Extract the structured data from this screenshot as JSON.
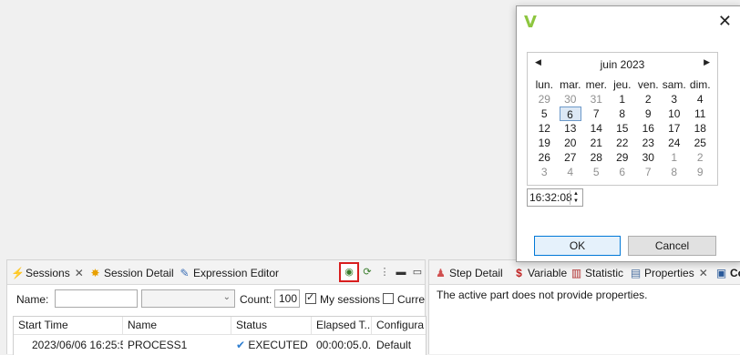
{
  "sessions_panel": {
    "tabs": [
      {
        "label": "Sessions",
        "icon": "lightning-icon"
      },
      {
        "label": "Session Detail",
        "icon": "session-detail-icon"
      },
      {
        "label": "Expression Editor",
        "icon": "pencil-icon"
      }
    ],
    "filter": {
      "name_label": "Name:",
      "name_value": "",
      "count_label": "Count:",
      "count_value": "100",
      "my_sessions_label": "My sessions",
      "my_sessions_checked": true,
      "current_label": "Curre",
      "current_checked": false
    },
    "table": {
      "columns": [
        "Start Time",
        "Name",
        "Status",
        "Elapsed T...",
        "Configura"
      ],
      "rows": [
        [
          "2023/06/06 16:25:5",
          "PROCESS1",
          "EXECUTED",
          "00:00:05.0...",
          "Default"
        ]
      ]
    }
  },
  "props_panel": {
    "tabs": [
      {
        "label": "Step Detail",
        "icon": "step-detail-icon"
      },
      {
        "label": "Variable",
        "icon": "variable-icon"
      },
      {
        "label": "Statistic",
        "icon": "statistic-icon"
      },
      {
        "label": "Properties",
        "icon": "properties-icon"
      },
      {
        "label": "Co",
        "icon": "console-icon"
      }
    ],
    "message": "The active part does not provide properties."
  },
  "dialog": {
    "month_label": "juin 2023",
    "weekdays": [
      "lun.",
      "mar.",
      "mer.",
      "jeu.",
      "ven.",
      "sam.",
      "dim."
    ],
    "weeks": [
      [
        "29",
        "30",
        "31",
        "1",
        "2",
        "3",
        "4"
      ],
      [
        "5",
        "6",
        "7",
        "8",
        "9",
        "10",
        "11"
      ],
      [
        "12",
        "13",
        "14",
        "15",
        "16",
        "17",
        "18"
      ],
      [
        "19",
        "20",
        "21",
        "22",
        "23",
        "24",
        "25"
      ],
      [
        "26",
        "27",
        "28",
        "29",
        "30",
        "1",
        "2"
      ],
      [
        "3",
        "4",
        "5",
        "6",
        "7",
        "8",
        "9"
      ]
    ],
    "selected_day": "6",
    "time_value": "16:32:08",
    "ok_label": "OK",
    "cancel_label": "Cancel"
  }
}
